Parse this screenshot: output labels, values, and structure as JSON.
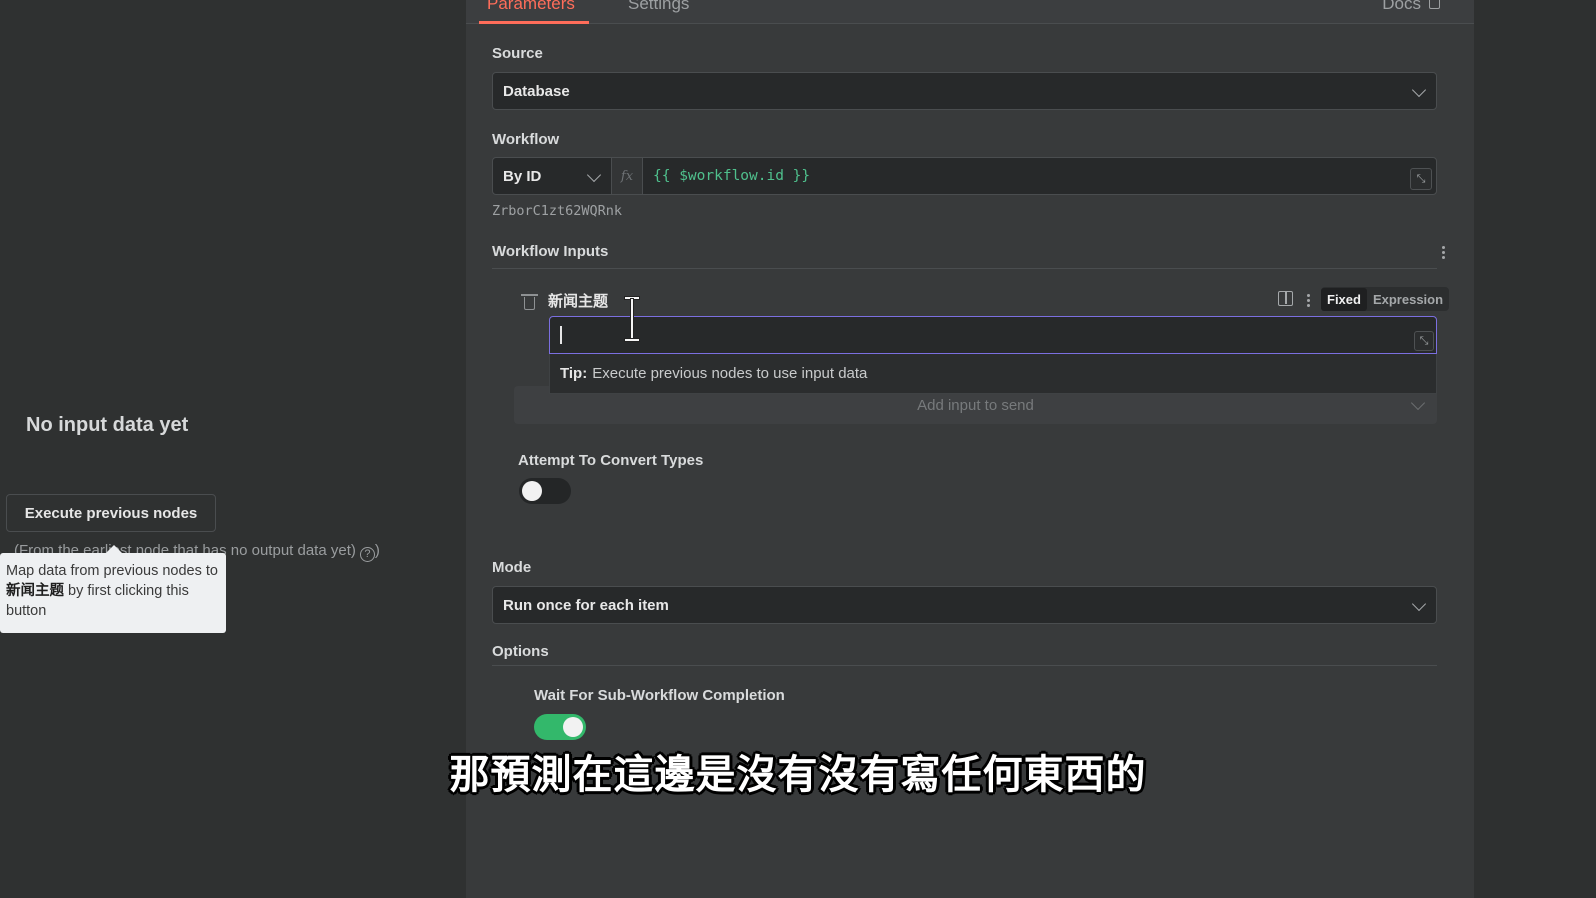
{
  "left": {
    "no_input_title": "No input data yet",
    "execute_button": "Execute previous nodes",
    "hint_text": "(From the earliest node that has no output data yet)",
    "help_icon": "?",
    "help_close": ")",
    "tooltip": {
      "prefix": "Map data from previous nodes to ",
      "field": "新闻主题",
      "suffix": " by first clicking this button"
    }
  },
  "tabs": {
    "parameters": "Parameters",
    "settings": "Settings",
    "docs": "Docs",
    "active": "parameters"
  },
  "source": {
    "label": "Source",
    "value": "Database"
  },
  "workflow": {
    "label": "Workflow",
    "mode": "By ID",
    "fx_icon": "fx",
    "expression": "{{ $workflow.id }}",
    "resolved_id": "ZrborC1zt62WQRnk"
  },
  "workflow_inputs": {
    "label": "Workflow Inputs",
    "field_label": "新闻主题",
    "fixed_label": "Fixed",
    "expression_label": "Expression",
    "selected_mode": "Fixed",
    "input_value": "",
    "tip_label": "Tip:",
    "tip_text": "Execute previous nodes to use input data",
    "add_input_label": "Add input to send"
  },
  "attempt_convert": {
    "label": "Attempt To Convert Types",
    "enabled": false
  },
  "mode": {
    "label": "Mode",
    "value": "Run once for each item"
  },
  "options": {
    "label": "Options",
    "wait_label": "Wait For Sub-Workflow Completion",
    "wait_enabled": true
  },
  "subtitle": "那預測在這邊是沒有沒有寫任何東西的",
  "colors": {
    "accent": "#ff6d5a",
    "focus": "#7b6fe0",
    "toggle_on": "#33b86b",
    "expression_text": "#4fc08d"
  }
}
